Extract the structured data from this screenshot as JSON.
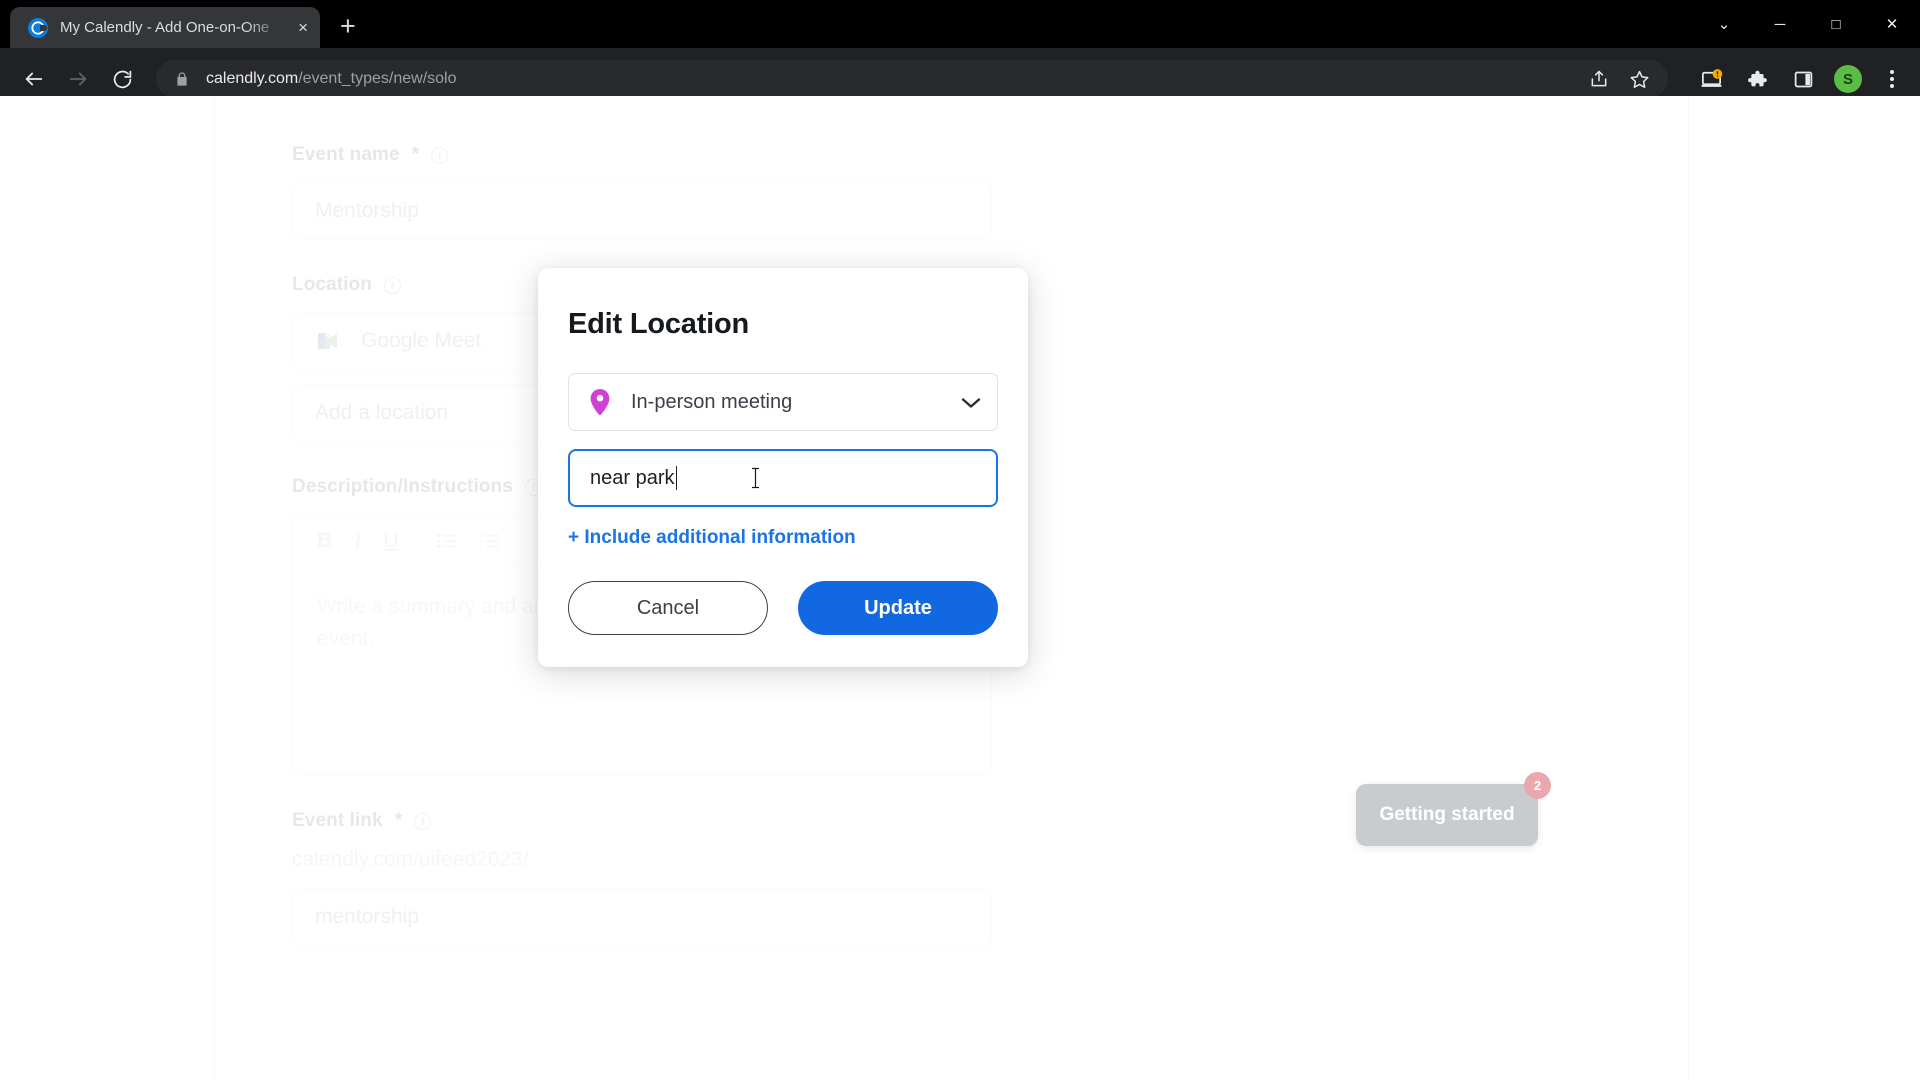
{
  "browser": {
    "tab": {
      "title": "My Calendly - Add One-on-One",
      "favicon": "calendly-favicon",
      "close": "×"
    },
    "new_tab_label": "+",
    "window_controls": {
      "minimize_chevron": "⌄",
      "minimize": "─",
      "maximize": "□",
      "close": "✕"
    },
    "nav": {
      "back": "←",
      "forward": "→",
      "reload": "↻"
    },
    "omnibox": {
      "domain": "calendly.com",
      "path": "/event_types/new/solo",
      "lock": "lock-icon"
    },
    "omni_actions": [
      "share-icon",
      "bookmark-star-icon"
    ],
    "extensions": [
      "update-laptop-icon",
      "puzzle-extensions-icon",
      "side-panel-icon"
    ],
    "avatar_initial": "S",
    "menu": "kebab-menu-icon"
  },
  "form": {
    "event_name": {
      "label": "Event name",
      "required": "*",
      "value": "Mentorship",
      "info": "info-icon"
    },
    "location": {
      "label": "Location",
      "info": "info-icon",
      "selected": "Google Meet",
      "selected_icon": "google-meet-icon",
      "add_placeholder": "Add a location"
    },
    "description": {
      "label": "Description/Instructions",
      "info": "info-icon",
      "placeholder": "Write a summary and any details your invitee should know about the event.",
      "toolbar": [
        {
          "name": "bold",
          "glyph": "B"
        },
        {
          "name": "italic",
          "glyph": "I"
        },
        {
          "name": "underline",
          "glyph": "U"
        },
        {
          "name": "bulleted-list",
          "glyph": ""
        },
        {
          "name": "numbered-list",
          "glyph": ""
        },
        {
          "name": "link",
          "glyph": ""
        },
        {
          "name": "undo",
          "glyph": ""
        },
        {
          "name": "redo",
          "glyph": ""
        }
      ]
    },
    "event_link": {
      "label": "Event link",
      "required": "*",
      "info": "info-icon",
      "prefix": "calendly.com/uifeed2023/",
      "value": "mentorship"
    }
  },
  "modal": {
    "title": "Edit Location",
    "location_type": {
      "value": "In-person meeting",
      "icon": "map-pin-icon",
      "chevron": "chevron-down-icon"
    },
    "address_input": {
      "value": "near park",
      "focused": true
    },
    "additional_info_link": "+ Include additional information",
    "cancel_label": "Cancel",
    "update_label": "Update"
  },
  "getting_started": {
    "label": "Getting started",
    "badge_count": "2"
  },
  "colors": {
    "accent_blue": "#1268e0",
    "link_blue": "#1a73e8",
    "pin_magenta": "#d13fd8",
    "badge_pink": "#eca7ae",
    "avatar_green": "#5bbd45",
    "chrome_dark": "#202124"
  }
}
